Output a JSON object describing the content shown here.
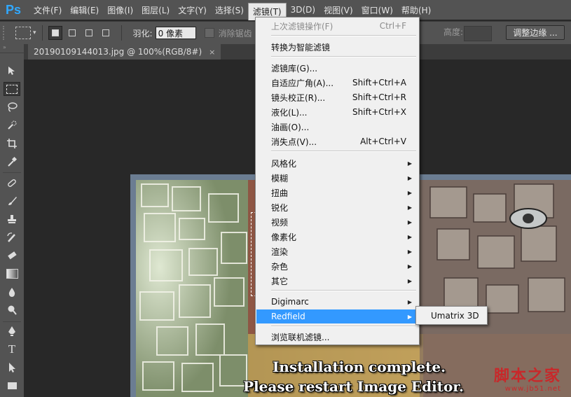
{
  "app": {
    "logo": "Ps",
    "accent": "#31a8ff"
  },
  "menubar": {
    "items": [
      "文件(F)",
      "编辑(E)",
      "图像(I)",
      "图层(L)",
      "文字(Y)",
      "选择(S)",
      "滤镜(T)",
      "3D(D)",
      "视图(V)",
      "窗口(W)",
      "帮助(H)"
    ],
    "active_index": 6
  },
  "options": {
    "feather_label": "羽化:",
    "feather_value": "0 像素",
    "antialias_label": "消除锯齿",
    "height_label": "高度:",
    "refine_button": "调整边缘 ..."
  },
  "document": {
    "tab_title": "20190109144013.jpg @ 100%(RGB/8#)",
    "close_glyph": "×"
  },
  "canvas": {
    "overlay_line1": "Installation complete.",
    "overlay_line2": "Please restart Image Editor.",
    "watermark_title": "脚本之家",
    "watermark_url": "www.jb51.net"
  },
  "filter_menu": {
    "items": [
      {
        "label": "上次滤镜操作(F)",
        "shortcut": "Ctrl+F",
        "state": "disabled"
      },
      {
        "label": "转换为智能滤镜",
        "shortcut": ""
      },
      {
        "label": "滤镜库(G)...",
        "shortcut": ""
      },
      {
        "label": "自适应广角(A)...",
        "shortcut": "Shift+Ctrl+A"
      },
      {
        "label": "镜头校正(R)...",
        "shortcut": "Shift+Ctrl+R"
      },
      {
        "label": "液化(L)...",
        "shortcut": "Shift+Ctrl+X"
      },
      {
        "label": "油画(O)...",
        "shortcut": ""
      },
      {
        "label": "消失点(V)...",
        "shortcut": "Alt+Ctrl+V"
      },
      {
        "label": "风格化",
        "submenu": true
      },
      {
        "label": "模糊",
        "submenu": true
      },
      {
        "label": "扭曲",
        "submenu": true
      },
      {
        "label": "锐化",
        "submenu": true
      },
      {
        "label": "视频",
        "submenu": true
      },
      {
        "label": "像素化",
        "submenu": true
      },
      {
        "label": "渲染",
        "submenu": true
      },
      {
        "label": "杂色",
        "submenu": true
      },
      {
        "label": "其它",
        "submenu": true
      },
      {
        "label": "Digimarc",
        "submenu": true
      },
      {
        "label": "Redfield",
        "submenu": true,
        "state": "hover"
      },
      {
        "label": "浏览联机滤镜...",
        "shortcut": ""
      }
    ],
    "highlight_color": "#3399ff"
  },
  "redfield_submenu": {
    "items": [
      "Umatrix 3D"
    ]
  }
}
